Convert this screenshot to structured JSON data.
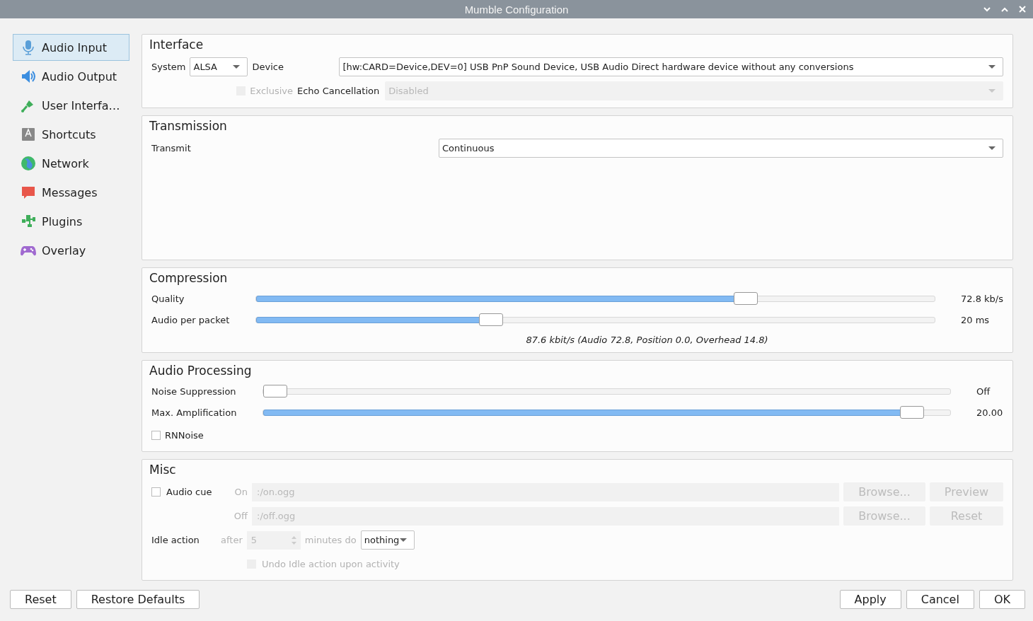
{
  "window": {
    "title": "Mumble Configuration"
  },
  "sidebar": {
    "items": [
      {
        "label": "Audio Input",
        "kind": "microphone",
        "selected": true
      },
      {
        "label": "Audio Output",
        "kind": "speaker",
        "selected": false
      },
      {
        "label": "User Interfa…",
        "kind": "brush",
        "selected": false
      },
      {
        "label": "Shortcuts",
        "kind": "key",
        "selected": false
      },
      {
        "label": "Network",
        "kind": "globe",
        "selected": false
      },
      {
        "label": "Messages",
        "kind": "bubble",
        "selected": false
      },
      {
        "label": "Plugins",
        "kind": "puzzle",
        "selected": false
      },
      {
        "label": "Overlay",
        "kind": "gamepad",
        "selected": false
      }
    ]
  },
  "interface": {
    "title": "Interface",
    "system_label": "System",
    "system_value": "ALSA",
    "device_label": "Device",
    "device_value": "[hw:CARD=Device,DEV=0] USB PnP Sound Device, USB Audio Direct hardware device without any conversions",
    "exclusive": {
      "label": "Exclusive",
      "checked": false,
      "disabled": true
    },
    "echo_label": "Echo Cancellation",
    "echo": {
      "value": "Disabled",
      "disabled": true
    }
  },
  "transmission": {
    "title": "Transmission",
    "transmit_label": "Transmit",
    "transmit_value": "Continuous"
  },
  "compression": {
    "title": "Compression",
    "sliders": [
      {
        "label": "Quality",
        "level": 0.73,
        "reading": "72.8 kb/s"
      },
      {
        "label": "Audio per packet",
        "level": 0.34,
        "reading": "20 ms"
      }
    ],
    "summary": "87.6 kbit/s (Audio 72.8, Position 0.0, Overhead 14.8)"
  },
  "audio_processing": {
    "title": "Audio Processing",
    "sliders": [
      {
        "label": "Noise Suppression",
        "level": 0,
        "reading": "Off"
      },
      {
        "label": "Max. Amplification",
        "level": 0.96,
        "reading": "20.00"
      }
    ],
    "rnnoise": {
      "label": "RNNoise",
      "checked": false
    }
  },
  "misc": {
    "title": "Misc",
    "audio_cue": {
      "label": "Audio cue",
      "checked": false
    },
    "cues": [
      {
        "label": "On",
        "value": ":/on.ogg",
        "browse": "Browse...",
        "action": "Preview",
        "disabled": true
      },
      {
        "label": "Off",
        "value": ":/off.ogg",
        "browse": "Browse...",
        "action": "Reset",
        "disabled": true
      }
    ],
    "idle_label": "Idle action",
    "after_label": "after",
    "after_value": "5",
    "minutes_label": "minutes do",
    "idle_value": "nothing",
    "undo": {
      "label": "Undo Idle action upon activity",
      "checked": false,
      "disabled": true
    }
  },
  "buttons_left": [
    "Reset",
    "Restore Defaults"
  ],
  "buttons_right": [
    "Apply",
    "Cancel",
    "OK"
  ]
}
